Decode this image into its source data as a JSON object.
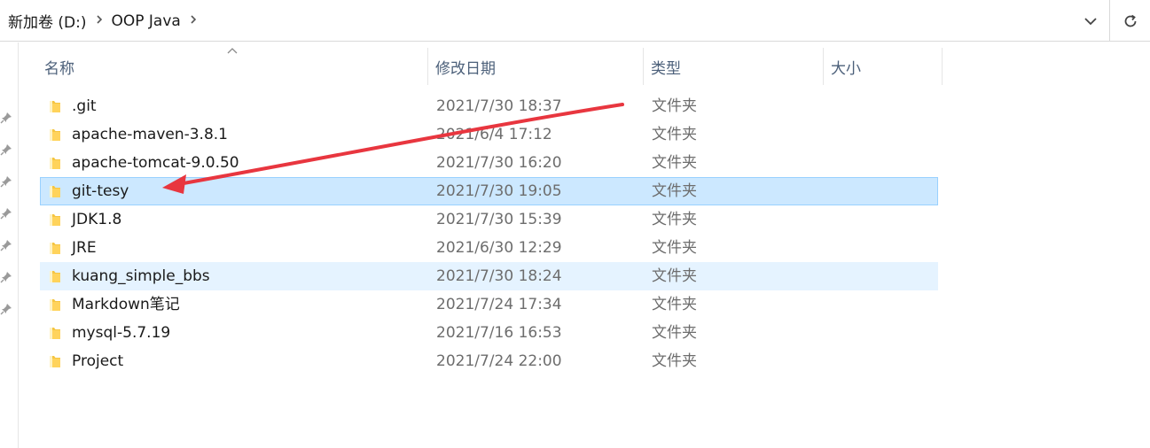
{
  "breadcrumb": [
    {
      "label": "新加卷 (D:)"
    },
    {
      "label": "OOP Java"
    }
  ],
  "columns": {
    "name": "名称",
    "date_modified": "修改日期",
    "type": "类型",
    "size": "大小"
  },
  "rows": [
    {
      "name": ".git",
      "date": "2021/7/30 18:37",
      "type": "文件夹",
      "state": "normal"
    },
    {
      "name": "apache-maven-3.8.1",
      "date": "2021/6/4 17:12",
      "type": "文件夹",
      "state": "normal"
    },
    {
      "name": "apache-tomcat-9.0.50",
      "date": "2021/7/30 16:20",
      "type": "文件夹",
      "state": "normal"
    },
    {
      "name": "git-tesy",
      "date": "2021/7/30 19:05",
      "type": "文件夹",
      "state": "selected"
    },
    {
      "name": "JDK1.8",
      "date": "2021/7/30 15:39",
      "type": "文件夹",
      "state": "normal"
    },
    {
      "name": "JRE",
      "date": "2021/6/30 12:29",
      "type": "文件夹",
      "state": "normal"
    },
    {
      "name": "kuang_simple_bbs",
      "date": "2021/7/30 18:24",
      "type": "文件夹",
      "state": "hover"
    },
    {
      "name": "Markdown笔记",
      "date": "2021/7/24 17:34",
      "type": "文件夹",
      "state": "normal"
    },
    {
      "name": "mysql-5.7.19",
      "date": "2021/7/16 16:53",
      "type": "文件夹",
      "state": "normal"
    },
    {
      "name": "Project",
      "date": "2021/7/24 22:00",
      "type": "文件夹",
      "state": "normal"
    }
  ],
  "icons": {
    "folder": "folder-icon",
    "chevron_right": "chevron-right-icon",
    "chevron_down": "chevron-down-icon",
    "refresh": "refresh-icon",
    "pin": "pin-icon",
    "sort": "sort-ascending-icon"
  },
  "colors": {
    "selected_bg": "#cce8ff",
    "selected_border": "#99d1ff",
    "hover_bg": "#e5f3ff",
    "header_text": "#4c607a",
    "secondary_text": "#6d6d6d",
    "folder": "#ffd35b",
    "annotation_arrow": "#e8363f"
  }
}
